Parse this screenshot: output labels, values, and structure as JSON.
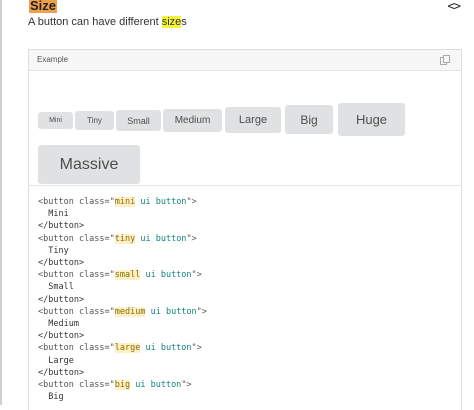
{
  "header": {
    "title": "Size",
    "subtitle_before": "A button can have different ",
    "subtitle_highlight": "size",
    "subtitle_after": "s",
    "code_toggle_icon": "code-toggle-icon",
    "code_toggle_glyph": "<>"
  },
  "example": {
    "label": "Example",
    "copy_icon": "copy-icon"
  },
  "buttons": [
    {
      "key": "mini",
      "label": "Mini"
    },
    {
      "key": "tiny",
      "label": "Tiny"
    },
    {
      "key": "small",
      "label": "Small"
    },
    {
      "key": "medium",
      "label": "Medium"
    },
    {
      "key": "large",
      "label": "Large"
    },
    {
      "key": "big",
      "label": "Big"
    },
    {
      "key": "huge",
      "label": "Huge"
    },
    {
      "key": "massive",
      "label": "Massive"
    }
  ],
  "code": {
    "lines": [
      {
        "open": "<button class=\"",
        "cls": "mini",
        "rest": " ui button\">"
      },
      {
        "text": "  Mini"
      },
      {
        "close": "</button>"
      },
      {
        "open": "<button class=\"",
        "cls": "tiny",
        "rest": " ui button\">"
      },
      {
        "text": "  Tiny"
      },
      {
        "close": "</button>"
      },
      {
        "open": "<button class=\"",
        "cls": "small",
        "rest": " ui button\">"
      },
      {
        "text": "  Small"
      },
      {
        "close": "</button>"
      },
      {
        "open": "<button class=\"",
        "cls": "medium",
        "rest": " ui button\">"
      },
      {
        "text": "  Medium"
      },
      {
        "close": "</button>"
      },
      {
        "open": "<button class=\"",
        "cls": "large",
        "rest": " ui button\">"
      },
      {
        "text": "  Large"
      },
      {
        "close": "</button>"
      },
      {
        "open": "<button class=\"",
        "cls": "big",
        "rest": " ui button\">"
      },
      {
        "text": "  Big"
      }
    ]
  },
  "colors": {
    "title_highlight": "#f0a04b",
    "search_highlight": "#f5f53a",
    "button_bg": "#e0e1e2",
    "button_text": "#4d4d4d"
  }
}
